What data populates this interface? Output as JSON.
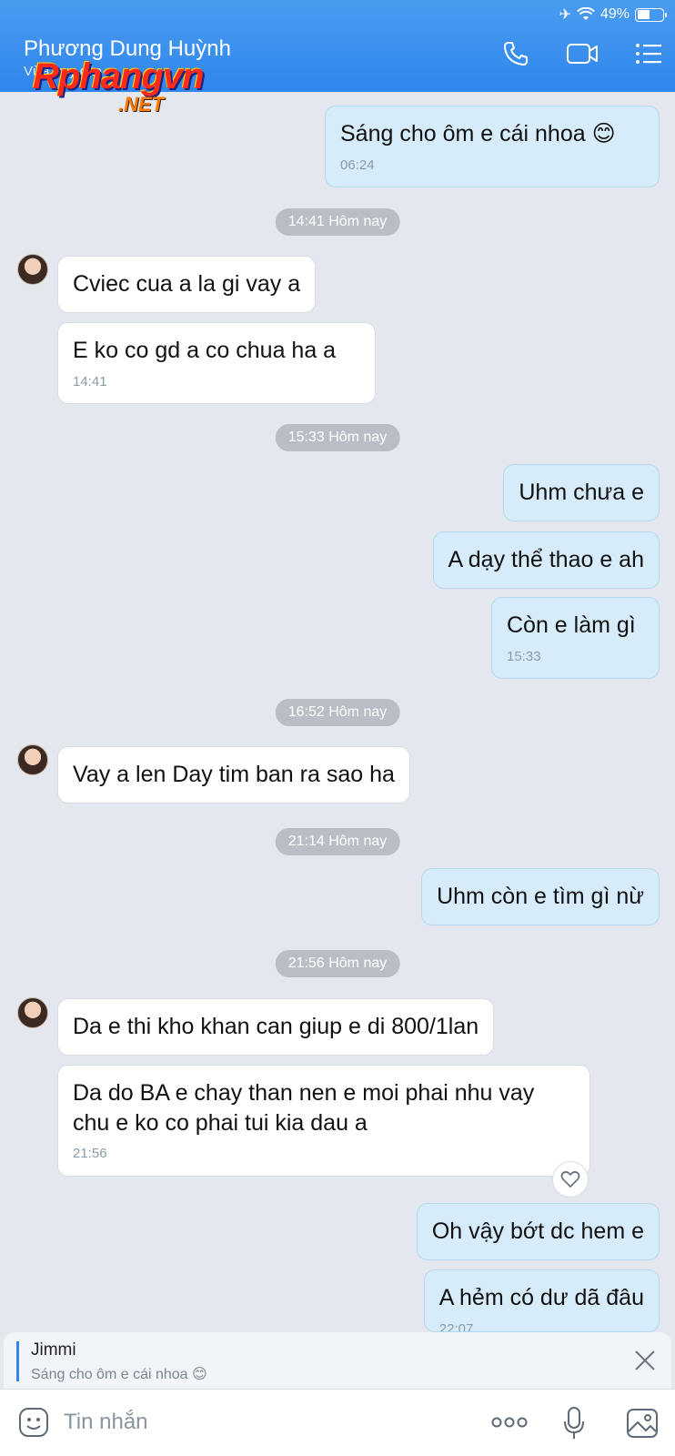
{
  "status_bar": {
    "battery": "49%",
    "battery_level": 0.49
  },
  "header": {
    "contact_name": "Phương Dung Huỳnh",
    "subtitle": "Vừa truy cập",
    "watermark_main": "Rphangvn",
    "watermark_sub": ".NET",
    "icons": [
      "phone-icon",
      "video-call-icon",
      "list-menu-icon"
    ]
  },
  "messages": [
    {
      "id": "m1",
      "dir": "out",
      "text": "Sáng cho ôm e cái nhoa 😊",
      "time": "06:24"
    },
    {
      "id": "d1",
      "type": "divider",
      "text": "14:41 Hôm nay"
    },
    {
      "id": "m2",
      "dir": "in",
      "text": "Cviec cua a la gi vay a"
    },
    {
      "id": "m3",
      "dir": "in",
      "text": "E ko co gd a co chua ha a",
      "time": "14:41"
    },
    {
      "id": "d2",
      "type": "divider",
      "text": "15:33 Hôm nay"
    },
    {
      "id": "m4",
      "dir": "out",
      "text": "Uhm chưa e"
    },
    {
      "id": "m5",
      "dir": "out",
      "text": "A dạy thể thao e ah"
    },
    {
      "id": "m6",
      "dir": "out",
      "text": "Còn e làm gì",
      "time": "15:33"
    },
    {
      "id": "d3",
      "type": "divider",
      "text": "16:52 Hôm nay"
    },
    {
      "id": "m7",
      "dir": "in",
      "text": "Vay a len Day tim ban ra sao ha"
    },
    {
      "id": "d4",
      "type": "divider",
      "text": "21:14 Hôm nay"
    },
    {
      "id": "m8",
      "dir": "out",
      "text": "Uhm còn e tìm gì nừ"
    },
    {
      "id": "d5",
      "type": "divider",
      "text": "21:56 Hôm nay"
    },
    {
      "id": "m9",
      "dir": "in",
      "text": "Da e thi kho khan can giup e di 800/1lan"
    },
    {
      "id": "m10",
      "dir": "in",
      "text": "Da do BA e chay than nen e moi phai nhu vay chu e ko co phai tui kia dau a",
      "time": "21:56"
    },
    {
      "id": "m11",
      "dir": "out",
      "text": "Oh vậy bớt dc hem e"
    },
    {
      "id": "m12",
      "dir": "out",
      "text": "A hẻm có dư dã đâu",
      "time": "22:07"
    }
  ],
  "reply_preview": {
    "name": "Jimmi",
    "text": "Sáng cho ôm e cái nhoa 😊"
  },
  "composer": {
    "placeholder": "Tin nhắn",
    "value": "",
    "more_label": "ooo"
  },
  "colors": {
    "header": "#2f86ec",
    "out_bubble": "#d7ecfb",
    "in_bubble": "#ffffff",
    "background": "#e4e8ee"
  }
}
